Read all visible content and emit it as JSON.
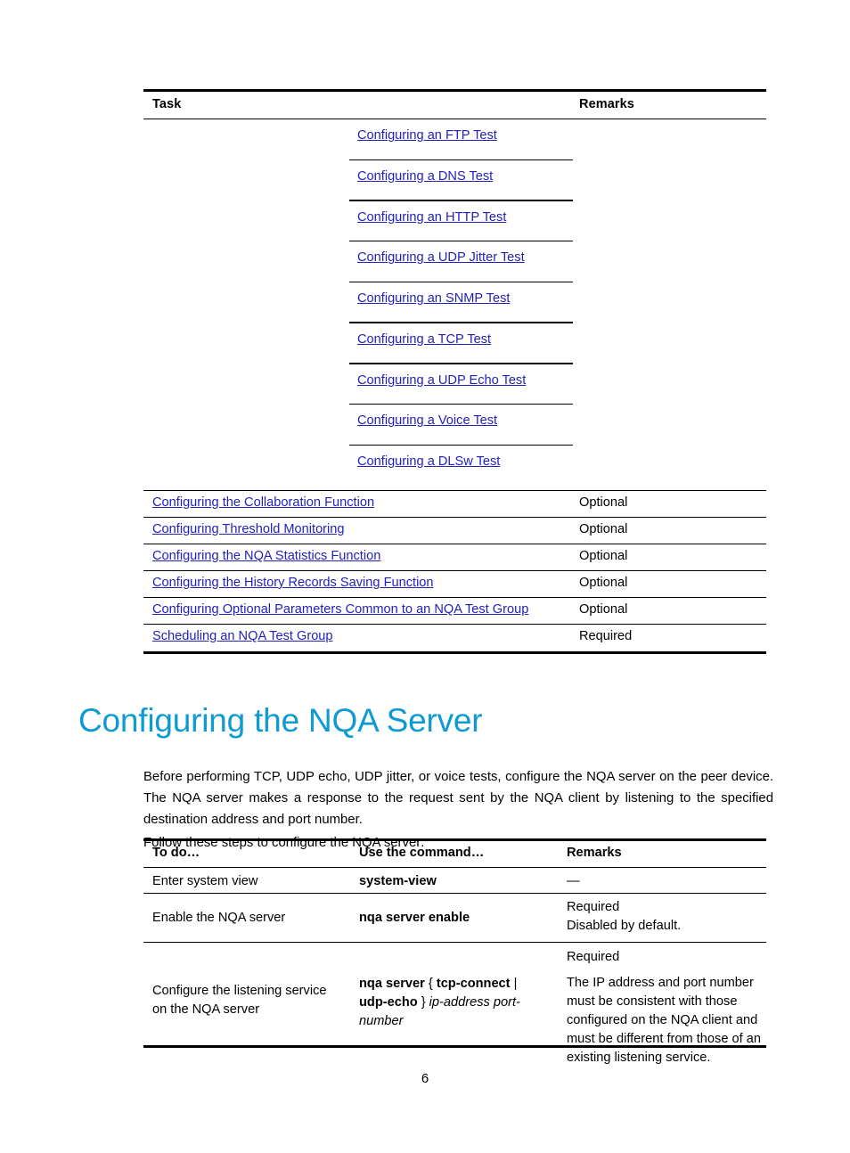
{
  "colors": {
    "heading": "#0e9ad2",
    "link": "#2222bb",
    "rule": "#000000"
  },
  "task_table": {
    "headers": {
      "task": "Task",
      "remarks": "Remarks"
    },
    "test_links": [
      "Configuring an FTP Test",
      "Configuring a DNS Test",
      "Configuring an HTTP Test",
      "Configuring a UDP Jitter Test",
      "Configuring an SNMP Test",
      "Configuring a TCP Test",
      "Configuring a UDP Echo Test",
      "Configuring a Voice Test",
      "Configuring a DLSw Test"
    ],
    "rows": [
      {
        "task": "Configuring the Collaboration Function",
        "remarks": "Optional"
      },
      {
        "task": "Configuring Threshold Monitoring",
        "remarks": "Optional"
      },
      {
        "task": "Configuring the NQA Statistics Function",
        "remarks": "Optional"
      },
      {
        "task": "Configuring the History Records Saving Function",
        "remarks": "Optional"
      },
      {
        "task": "Configuring Optional Parameters Common to an NQA Test Group",
        "remarks": "Optional"
      },
      {
        "task": "Scheduling an NQA Test Group",
        "remarks": "Required"
      }
    ]
  },
  "section": {
    "heading": "Configuring the NQA Server",
    "paragraph": "Before performing TCP, UDP echo, UDP jitter, or voice tests, configure the NQA server on the peer device. The NQA server makes a response to the request sent by the NQA client by listening to the specified destination address and port number.",
    "lead_in": "Follow these steps to configure the NQA server:"
  },
  "steps_table": {
    "headers": {
      "todo": "To do…",
      "command": "Use the command…",
      "remarks": "Remarks"
    },
    "rows": [
      {
        "todo": "Enter system view",
        "command": "system-view",
        "remarks": "—"
      },
      {
        "todo": "Enable the NQA server",
        "command": "nqa server enable",
        "remarks_line1": "Required",
        "remarks_line2": "Disabled by default."
      },
      {
        "todo": "Configure the listening service on the NQA server",
        "command_bold_1": "nqa server",
        "command_brace_open": "{",
        "command_bold_2": "tcp-connect",
        "command_pipe": "|",
        "command_bold_3": "udp-echo",
        "command_brace_close": "}",
        "command_italic_1": "ip-address",
        "command_italic_2": "port-number",
        "remarks_line1": "Required",
        "remarks_line2": "The IP address and port number must be consistent with those configured on the NQA client and must be different from those of an existing listening service."
      }
    ]
  },
  "footer": {
    "page_number": "6"
  }
}
